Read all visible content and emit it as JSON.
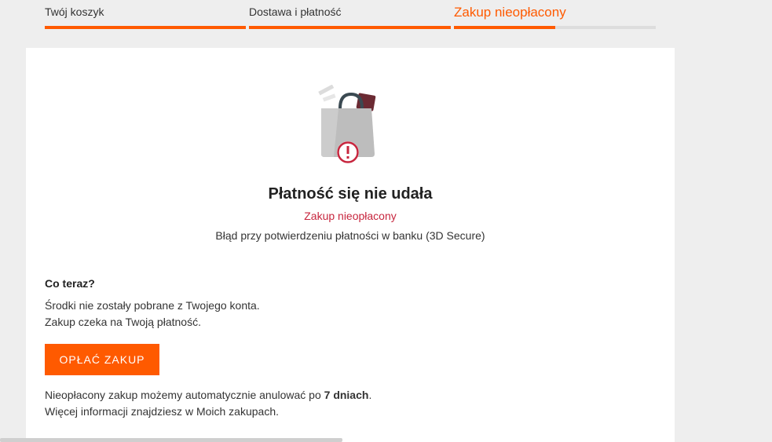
{
  "steps": [
    {
      "label": "Twój koszyk",
      "progress": 1.0
    },
    {
      "label": "Dostawa i płatność",
      "progress": 1.0
    },
    {
      "label": "Zakup nieopłacony",
      "progress": 0.5,
      "current": true
    }
  ],
  "result": {
    "icon": "shopping-bag-error-icon",
    "title": "Płatność się nie udała",
    "status": "Zakup nieopłacony",
    "error": "Błąd przy potwierdzeniu płatności w banku (3D Secure)"
  },
  "next_steps": {
    "heading": "Co teraz?",
    "line1": "Środki nie zostały pobrane z Twojego konta.",
    "line2": "Zakup czeka na Twoją płatność.",
    "pay_button": "OPŁAĆ ZAKUP",
    "cancel_prefix": "Nieopłacony zakup możemy automatycznie anulować po ",
    "cancel_days": "7 dniach",
    "cancel_suffix": ".",
    "more_info": "Więcej informacji znajdziesz w Moich zakupach."
  },
  "colors": {
    "accent": "#ff5a00",
    "error": "#c7263e",
    "track": "#dddddd"
  }
}
